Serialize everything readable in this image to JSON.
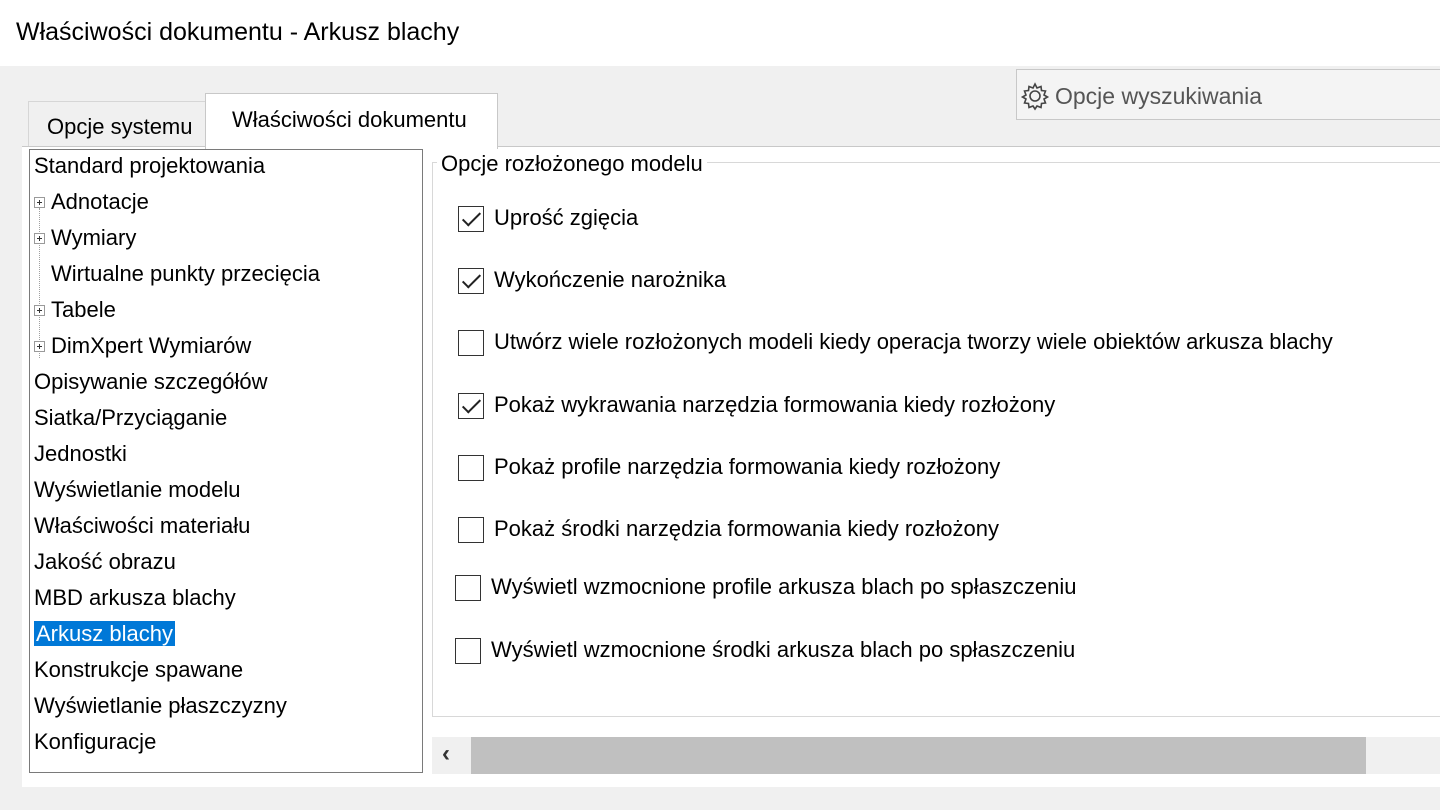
{
  "window": {
    "title": "Właściwości dokumentu - Arkusz blachy"
  },
  "search": {
    "placeholder": "Opcje wyszukiwania",
    "icon": "gear-icon"
  },
  "tabs": [
    {
      "label": "Opcje systemu",
      "active": false
    },
    {
      "label": "Właściwości dokumentu",
      "active": true
    }
  ],
  "tree": {
    "items": [
      {
        "label": "Standard projektowania",
        "expandable": false
      },
      {
        "label": "Adnotacje",
        "expandable": true
      },
      {
        "label": "Wymiary",
        "expandable": true
      },
      {
        "label": "Wirtualne punkty przecięcia",
        "expandable": false
      },
      {
        "label": "Tabele",
        "expandable": true
      },
      {
        "label": "DimXpert Wymiarów",
        "expandable": true
      },
      {
        "label": "Opisywanie szczegółów",
        "expandable": false
      },
      {
        "label": "Siatka/Przyciąganie",
        "expandable": false
      },
      {
        "label": "Jednostki",
        "expandable": false
      },
      {
        "label": "Wyświetlanie modelu",
        "expandable": false
      },
      {
        "label": "Właściwości materiału",
        "expandable": false
      },
      {
        "label": "Jakość obrazu",
        "expandable": false
      },
      {
        "label": "MBD arkusza blachy",
        "expandable": false
      },
      {
        "label": "Arkusz blachy",
        "expandable": false,
        "selected": true
      },
      {
        "label": "Konstrukcje spawane",
        "expandable": false
      },
      {
        "label": "Wyświetlanie płaszczyzny",
        "expandable": false
      },
      {
        "label": "Konfiguracje",
        "expandable": false
      }
    ]
  },
  "options": {
    "group_title": "Opcje rozłożonego modelu",
    "items": [
      {
        "label": "Uprość zgięcia",
        "checked": true
      },
      {
        "label": "Wykończenie narożnika",
        "checked": true
      },
      {
        "label": "Utwórz wiele rozłożonych modeli kiedy operacja tworzy wiele obiektów arkusza blachy",
        "checked": false
      },
      {
        "label": "Pokaż wykrawania narzędzia formowania kiedy rozłożony",
        "checked": true
      },
      {
        "label": "Pokaż profile narzędzia formowania kiedy rozłożony",
        "checked": false
      },
      {
        "label": "Pokaż środki narzędzia formowania kiedy rozłożony",
        "checked": false
      },
      {
        "label": "Wyświetl wzmocnione profile arkusza blach po spłaszczeniu",
        "checked": false
      },
      {
        "label": "Wyświetl wzmocnione środki arkusza blach po spłaszczeniu",
        "checked": false
      }
    ]
  },
  "colors": {
    "selection": "#0078d7",
    "scroll_thumb": "#c0c0c0"
  }
}
